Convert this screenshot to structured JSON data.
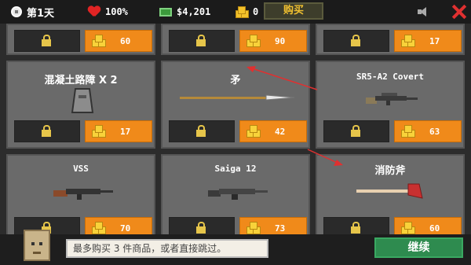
{
  "topbar": {
    "day": "第1天",
    "health": "100%",
    "cash": "$4,201",
    "coins": "0",
    "buy_label": "购买"
  },
  "cards": [
    {
      "title": "",
      "price": "60"
    },
    {
      "title": "",
      "price": "90"
    },
    {
      "title": "",
      "price": "17"
    },
    {
      "title": "混凝土路障 X 2",
      "price": "17"
    },
    {
      "title": "矛",
      "price": "42"
    },
    {
      "title": "SR5-A2 Covert",
      "price": "63"
    },
    {
      "title": "VSS",
      "price": "70"
    },
    {
      "title": "Saiga 12",
      "price": "73"
    },
    {
      "title": "消防斧",
      "price": "60"
    }
  ],
  "tip": "最多购买 3 件商品，或者直接跳过。",
  "continue_label": "继续",
  "colors": {
    "price_orange": "#f08a1a",
    "continue_green": "#2e8b4f",
    "arrow_red": "#e03030",
    "coin_yellow": "#f8d23a"
  }
}
